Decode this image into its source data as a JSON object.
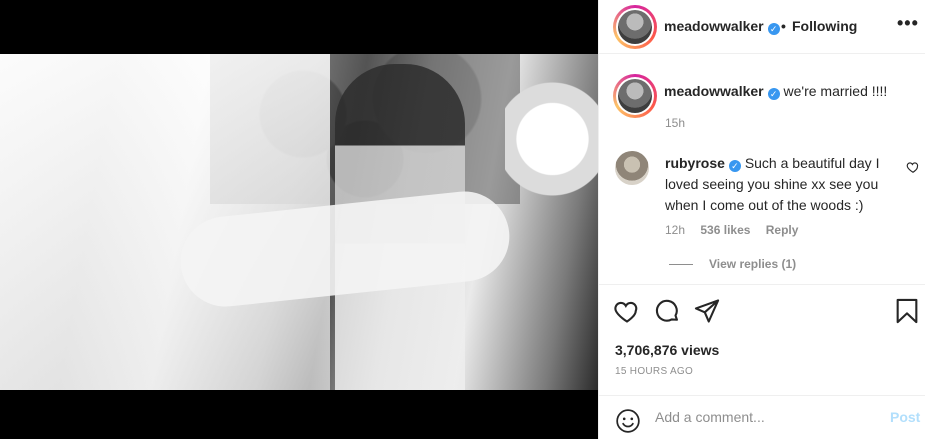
{
  "header": {
    "username": "meadowwalker",
    "separator": "•",
    "follow_status": "Following",
    "more_label": "•••"
  },
  "caption": {
    "username": "meadowwalker",
    "text": "we're married !!!!",
    "time": "15h"
  },
  "comment": {
    "username": "rubyrose",
    "text": "Such a beautiful day I loved seeing you shine xx see you when I come out of the woods :)",
    "time": "12h",
    "likes": "536 likes",
    "reply_label": "Reply",
    "view_replies": "View replies (1)"
  },
  "stats": {
    "views": "3,706,876 views",
    "posted": "15 HOURS AGO"
  },
  "add_comment": {
    "placeholder": "Add a comment...",
    "post_label": "Post"
  },
  "icons": {
    "verified": "verified-badge-icon",
    "like": "heart-icon",
    "comment": "comment-bubble-icon",
    "share": "paper-plane-icon",
    "save": "bookmark-icon",
    "emoji": "emoji-icon"
  },
  "colors": {
    "verified": "#3897f0",
    "secondary_text": "#8e8e8e",
    "post_disabled": "#b2dffc"
  }
}
